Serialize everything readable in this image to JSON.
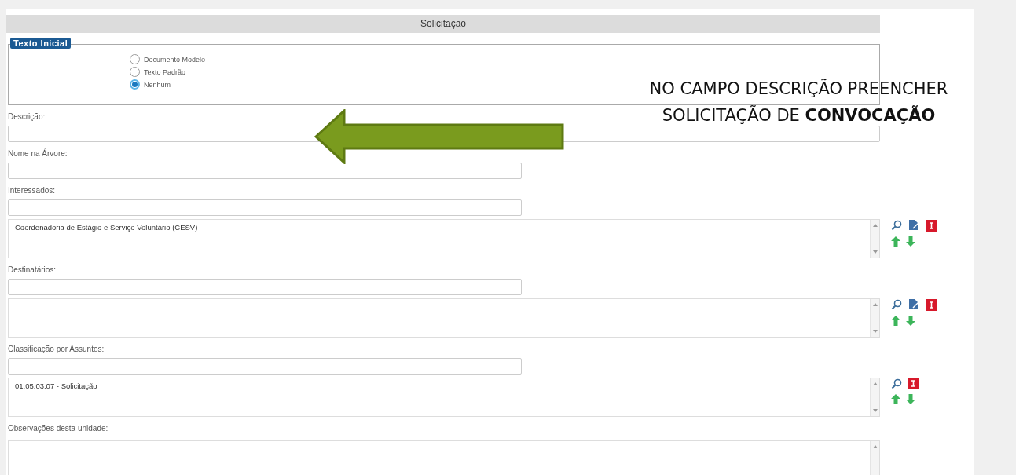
{
  "header": {
    "title": "Solicitação"
  },
  "texto_inicial": {
    "legend": "Texto Inicial",
    "options": [
      {
        "label": "Documento Modelo",
        "selected": false
      },
      {
        "label": "Texto Padrão",
        "selected": false
      },
      {
        "label": "Nenhum",
        "selected": true
      }
    ]
  },
  "fields": [
    {
      "kind": "wide-input",
      "label": "Descrição:"
    },
    {
      "kind": "input",
      "label": "Nome na Árvore:"
    },
    {
      "kind": "selector",
      "label": "Interessados:",
      "items": [
        "Coordenadoria de Estágio e Serviço Voluntário (CESV)"
      ],
      "actions": [
        {
          "kind": "search"
        },
        {
          "kind": "edit"
        },
        {
          "kind": "remove"
        }
      ]
    },
    {
      "kind": "selector",
      "label": "Destinatários:",
      "actions": [
        {
          "kind": "search"
        },
        {
          "kind": "edit"
        },
        {
          "kind": "remove"
        }
      ]
    },
    {
      "kind": "selector",
      "label": "Classificação por Assuntos:",
      "items": [
        "01.05.03.07 - Solicitação"
      ],
      "actions": [
        {
          "kind": "search"
        },
        {
          "kind": "remove"
        }
      ]
    },
    {
      "kind": "textarea",
      "label": "Observações desta unidade:"
    }
  ],
  "annotation": {
    "lines": [
      "NO CAMPO DESCRIÇÃO PREENCHER",
      "SOLICITAÇÃO DE **CONVOCAÇÃO**"
    ]
  }
}
